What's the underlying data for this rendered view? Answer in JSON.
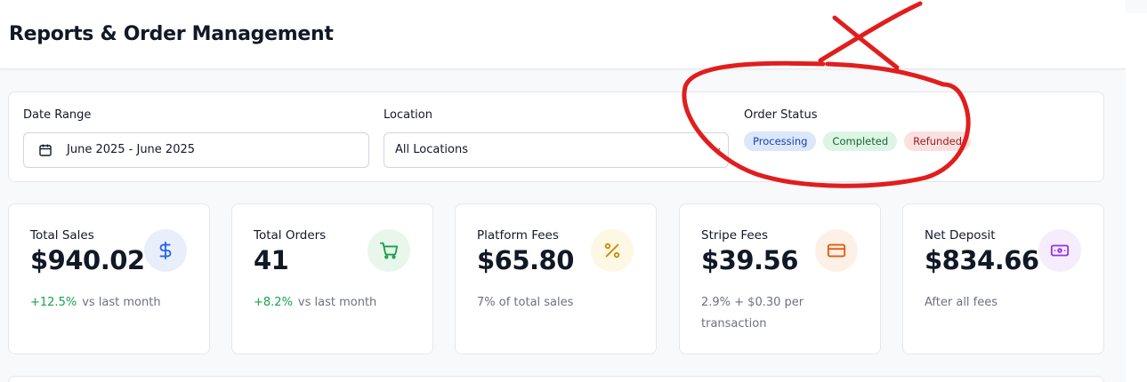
{
  "header": {
    "title": "Reports & Order Management"
  },
  "filters": {
    "date_range": {
      "label": "Date Range",
      "value": "June 2025 - June 2025",
      "icon": "calendar-icon"
    },
    "location": {
      "label": "Location",
      "value": "All Locations",
      "icon": "chevron-down-icon"
    },
    "order_status": {
      "label": "Order Status",
      "options": [
        "Processing",
        "Completed",
        "Refunded"
      ]
    }
  },
  "stats": [
    {
      "title": "Total Sales",
      "value": "$940.02",
      "delta": "+12.5%",
      "delta_text": "vs last month",
      "icon": "dollar-icon",
      "icon_color": "#2563eb",
      "icon_bg": "#e8effb"
    },
    {
      "title": "Total Orders",
      "value": "41",
      "delta": "+8.2%",
      "delta_text": "vs last month",
      "icon": "cart-icon",
      "icon_color": "#16a34a",
      "icon_bg": "#e8f6ec"
    },
    {
      "title": "Platform Fees",
      "value": "$65.80",
      "note": "7% of total sales",
      "icon": "percent-icon",
      "icon_color": "#ca8a04",
      "icon_bg": "#fdf8e4"
    },
    {
      "title": "Stripe Fees",
      "value": "$39.56",
      "note": "2.9% + $0.30 per transaction",
      "icon": "credit-card-icon",
      "icon_color": "#ea580c",
      "icon_bg": "#fdf1e7"
    },
    {
      "title": "Net Deposit",
      "value": "$834.66",
      "note": "After all fees",
      "icon": "money-icon",
      "icon_color": "#9333ea",
      "icon_bg": "#f5edfb"
    }
  ],
  "annotation_color": "#e11d1d"
}
